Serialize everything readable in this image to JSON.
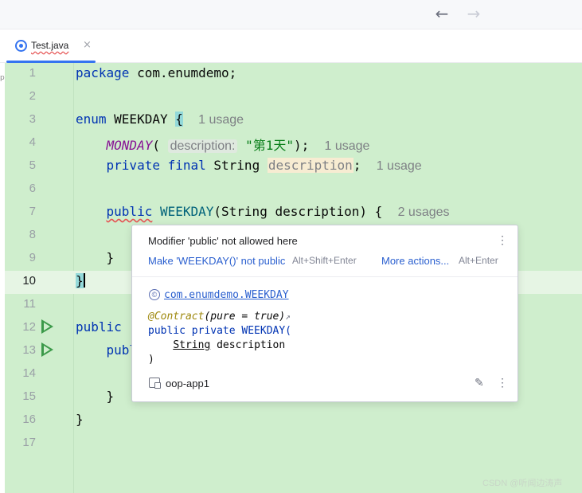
{
  "nav": {
    "back_icon": "arrow-left-icon",
    "forward_icon": "arrow-right-icon"
  },
  "tab": {
    "label": "Test.java",
    "close": "×"
  },
  "edge_strip_char": "p",
  "editor": {
    "line_numbers": [
      "1",
      "2",
      "3",
      "4",
      "5",
      "6",
      "7",
      "8",
      "9",
      "10",
      "11",
      "12",
      "13",
      "14",
      "15",
      "16",
      "17"
    ],
    "l1": {
      "kw": "package",
      "rest": " com.enumdemo;"
    },
    "l3": {
      "kw": "enum",
      "name": " WEEKDAY ",
      "brace": "{",
      "hint": "1 usage"
    },
    "l4": {
      "enum_const": "MONDAY",
      "paren": "(",
      "param_hint": "description:",
      "str": "\"第1天\"",
      "close": ");",
      "hint": "1 usage"
    },
    "l5": {
      "kw": "private final",
      "type": " String ",
      "field": "description",
      "semi": ";",
      "hint": "1 usage"
    },
    "l7": {
      "kw": "public",
      "ctor": " WEEKDAY",
      "rest": "(String description) {",
      "hint": "2 usages"
    },
    "l9": {
      "text": "}"
    },
    "l10": {
      "text": "}"
    },
    "l12": {
      "text": "public"
    },
    "l13": {
      "text": "publ"
    },
    "l15": {
      "text": "}"
    },
    "l16": {
      "text": "}"
    }
  },
  "popup": {
    "message": "Modifier 'public' not allowed here",
    "fix_label": "Make 'WEEKDAY()' not public",
    "fix_shortcut": "Alt+Shift+Enter",
    "more_label": "More actions...",
    "more_shortcut": "Alt+Enter",
    "class_icon": "©",
    "class_name": "com.enumdemo.WEEKDAY",
    "doc_line1_ann": "@Contract",
    "doc_line1_rest": "(pure = true)",
    "doc_line1_arrow": "↗",
    "doc_line2": "public private WEEKDAY(",
    "doc_line3_type": "String",
    "doc_line3_rest": " description",
    "doc_line4": ")",
    "module": "oop-app1"
  },
  "watermark": "CSDN @听闻边涛声",
  "colors": {
    "editor_bg": "#cfeecd",
    "keyword": "#0033b3",
    "string": "#067d17",
    "enum_const": "#871094",
    "link": "#2a5fcf"
  }
}
